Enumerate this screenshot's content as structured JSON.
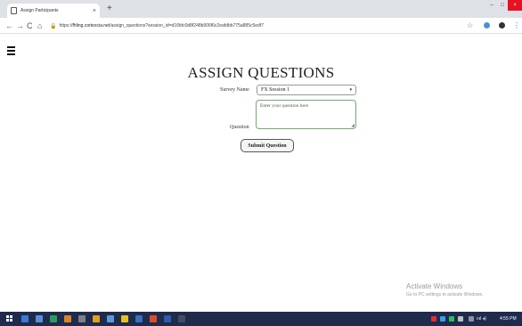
{
  "browser": {
    "tab_title": "Assign Participants",
    "tab_close": "×",
    "new_tab": "+",
    "window_controls": {
      "minimize": "–",
      "maximize": "□",
      "close": "×"
    },
    "nav": {
      "back": "←",
      "forward": "→",
      "reload": "C",
      "home": "⌂"
    },
    "url_prefix": "https://",
    "url_host": "fhling.cortexcia.net",
    "url_path": "/assign_questions?session_id=d16fdc0d8f248b906f6c2eafdbb775a885c5edf7",
    "star": "☆",
    "menu": "⋮"
  },
  "page": {
    "title": "ASSIGN QUESTIONS",
    "survey_label": "Survey Name",
    "survey_selected": "FX Session 1",
    "select_arrow": "▾",
    "question_label": "Question",
    "question_placeholder": "Enter your question here",
    "submit_label": "Submit Question"
  },
  "watermark": {
    "line1": "Activate Windows",
    "line2": "Go to PC settings to activate Windows."
  },
  "taskbar": {
    "clock": "4:55 PM",
    "tray_text": "ıııl ◂)"
  },
  "colors": {
    "taskbar": "#1f2b4d",
    "textarea_border": "#7aa47a",
    "close_button": "#e81123"
  }
}
